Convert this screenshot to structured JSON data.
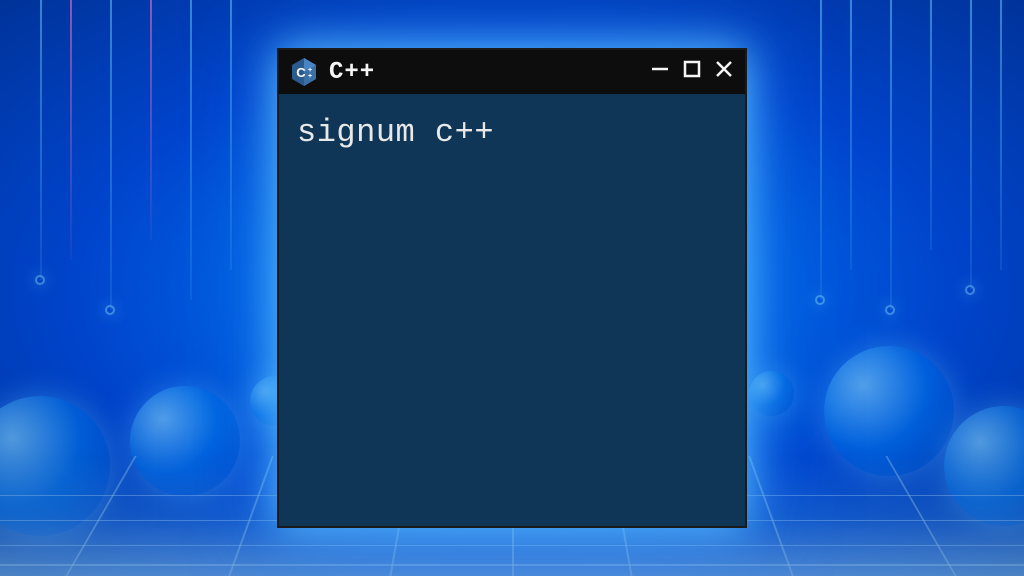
{
  "window": {
    "title": "C++",
    "content": "signum c++"
  },
  "colors": {
    "titlebar_bg": "#0d0d0d",
    "content_bg": "#0f3557",
    "text": "#e8e8e8",
    "bg_primary": "#0066dd"
  }
}
